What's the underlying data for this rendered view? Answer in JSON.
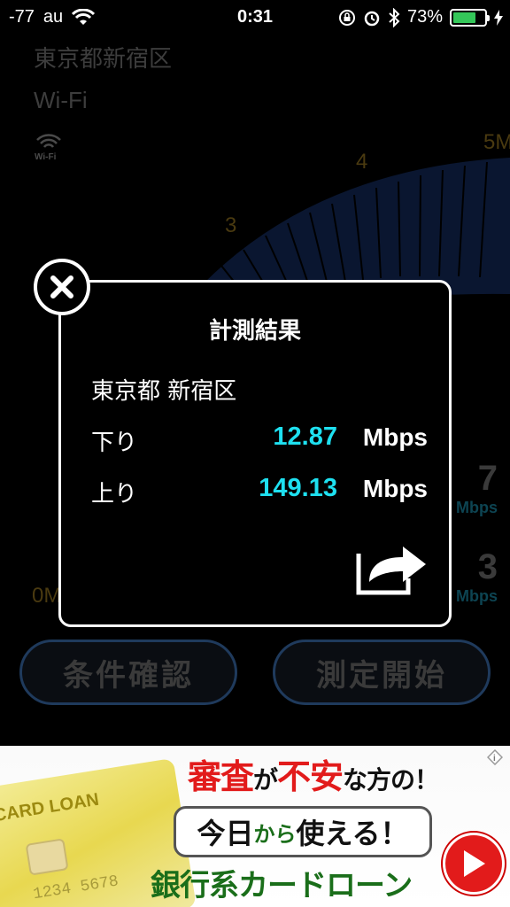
{
  "status_bar": {
    "signal": "-77",
    "carrier": "au",
    "time": "0:31",
    "battery_percent": "73%",
    "battery_level": 0.73,
    "icons": [
      "wifi-icon",
      "rotation-lock-icon",
      "alarm-icon",
      "bluetooth-icon",
      "battery-icon",
      "charging-icon"
    ]
  },
  "background_app": {
    "location": "東京都新宿区",
    "network_type": "Wi-Fi",
    "wifi_icon_label": "Wi-Fi",
    "gauge_labels": [
      "0M",
      "3",
      "4",
      "5M"
    ],
    "download_partial": "7",
    "upload_partial": "3",
    "unit_partial": "Mbps",
    "buttons": {
      "check_conditions": "条件確認",
      "start_measurement": "測定開始"
    }
  },
  "modal": {
    "title": "計測結果",
    "location": "東京都 新宿区",
    "download_label": "下り",
    "download_value": "12.87",
    "download_unit": "Mbps",
    "upload_label": "上り",
    "upload_value": "149.13",
    "upload_unit": "Mbps",
    "value_color": "#1ee0f0"
  },
  "ad": {
    "card_text": "CARD LOAN",
    "card_number": "1234 5678",
    "line1_a": "審査",
    "line1_b": "が",
    "line1_c": "不安",
    "line1_d": "な方の！",
    "line2_a": "今日",
    "line2_b": "から",
    "line2_c": "使える！",
    "line3": "銀行系カードローン",
    "accent_color": "#e21b1b"
  }
}
